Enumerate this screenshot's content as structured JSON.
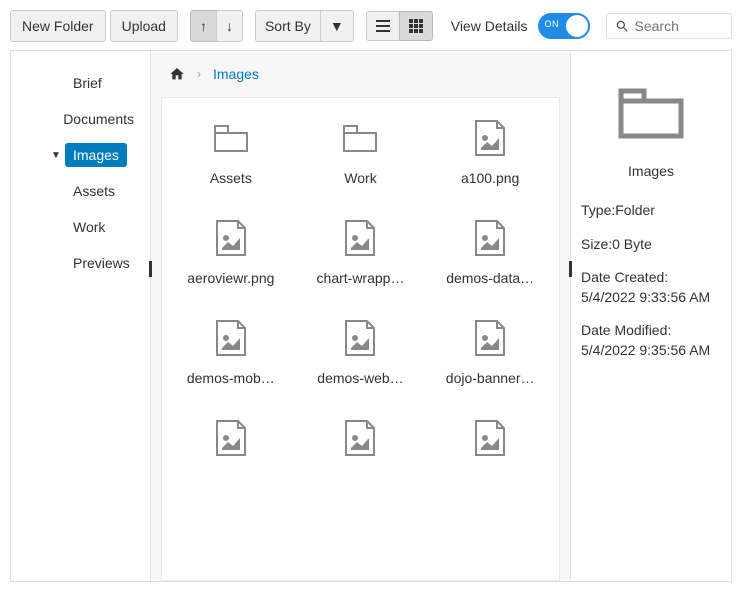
{
  "toolbar": {
    "new_folder": "New Folder",
    "upload": "Upload",
    "sort_by": "Sort By",
    "view_details": "View Details",
    "switch_on": "ON",
    "search_placeholder": "Search"
  },
  "tree": {
    "items": [
      {
        "label": "Brief",
        "level": 1,
        "selected": false,
        "expander": ""
      },
      {
        "label": "Documents",
        "level": 1,
        "selected": false,
        "expander": ""
      },
      {
        "label": "Images",
        "level": 1,
        "selected": true,
        "expander": "▼"
      },
      {
        "label": "Assets",
        "level": 2,
        "selected": false,
        "expander": ""
      },
      {
        "label": "Work",
        "level": 2,
        "selected": false,
        "expander": ""
      },
      {
        "label": "Previews",
        "level": 1,
        "selected": false,
        "expander": ""
      }
    ]
  },
  "breadcrumb": {
    "current": "Images"
  },
  "grid": {
    "items": [
      {
        "name": "Assets",
        "type": "folder"
      },
      {
        "name": "Work",
        "type": "folder"
      },
      {
        "name": "a100.png",
        "type": "image"
      },
      {
        "name": "aeroviewr.png",
        "type": "image"
      },
      {
        "name": "chart-wrapp…",
        "type": "image"
      },
      {
        "name": "demos-data…",
        "type": "image"
      },
      {
        "name": "demos-mob…",
        "type": "image"
      },
      {
        "name": "demos-web…",
        "type": "image"
      },
      {
        "name": "dojo-banner…",
        "type": "image"
      },
      {
        "name": "",
        "type": "image"
      },
      {
        "name": "",
        "type": "image"
      },
      {
        "name": "",
        "type": "image"
      }
    ]
  },
  "details": {
    "title": "Images",
    "type_label": "Type:",
    "type_value": "Folder",
    "size_label": "Size:",
    "size_value": "0 Byte",
    "created_label": "Date Created:",
    "created_value": "5/4/2022 9:33:56 AM",
    "modified_label": "Date Modified:",
    "modified_value": "5/4/2022 9:35:56 AM"
  }
}
